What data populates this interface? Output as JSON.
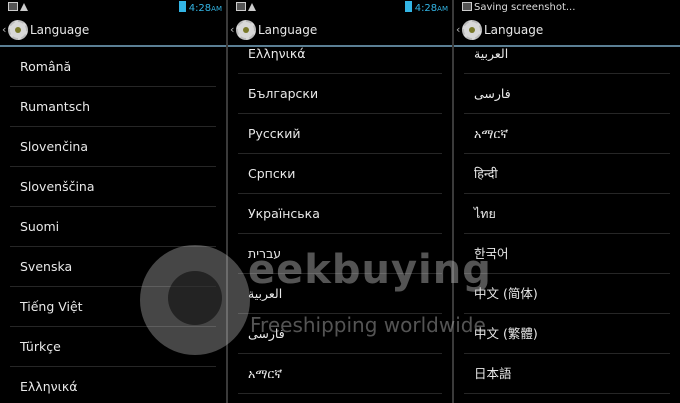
{
  "panels": [
    {
      "status": {
        "time": "4:28",
        "ampm": "AM"
      },
      "title": "Language",
      "items": [
        "Română",
        "Rumantsch",
        "Slovenčina",
        "Slovenščina",
        "Suomi",
        "Svenska",
        "Tiếng Việt",
        "Türkçe",
        "Ελληνικά"
      ]
    },
    {
      "status": {
        "time": "4:28",
        "ampm": "AM"
      },
      "title": "Language",
      "items": [
        "Ελληνικά",
        "Български",
        "Русский",
        "Српски",
        "Українська",
        "עברית",
        "العربية",
        "فارسی",
        "አማርኛ"
      ]
    },
    {
      "status": {
        "notification": "Saving screenshot..."
      },
      "title": "Language",
      "items": [
        "العربية",
        "فارسی",
        "አማርኛ",
        "हिन्दी",
        "ไทย",
        "한국어",
        "中文 (简体)",
        "中文 (繁體)",
        "日本語"
      ]
    }
  ],
  "watermark": {
    "brand": "eekbuying",
    "tagline": "Freeshipping worldwide"
  }
}
